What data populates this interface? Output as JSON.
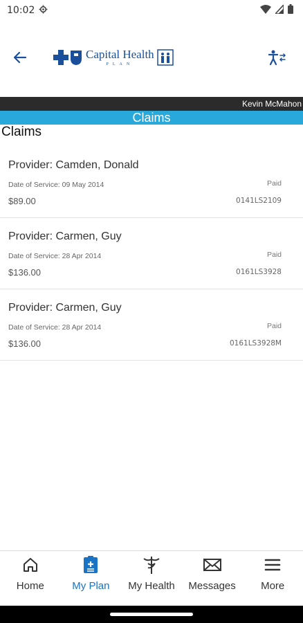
{
  "status_bar": {
    "time": "10:02"
  },
  "header": {
    "logo_name": "Capital Health",
    "logo_sub": "PLAN"
  },
  "user_bar": {
    "name": "Kevin McMahon"
  },
  "section_bar": {
    "title": "Claims"
  },
  "page": {
    "title": "Claims"
  },
  "claims": [
    {
      "provider": "Provider: Camden, Donald",
      "date": "Date of Service:  09 May 2014",
      "status": "Paid",
      "amount": "$89.00",
      "claim_id": "0141LS2109"
    },
    {
      "provider": "Provider: Carmen, Guy",
      "date": "Date of Service:  28 Apr 2014",
      "status": "Paid",
      "amount": "$136.00",
      "claim_id": "0161LS3928"
    },
    {
      "provider": "Provider: Carmen, Guy",
      "date": "Date of Service:  28 Apr 2014",
      "status": "Paid",
      "amount": "$136.00",
      "claim_id": "0161LS3928M"
    }
  ],
  "nav": {
    "home": "Home",
    "my_plan": "My Plan",
    "my_health": "My Health",
    "messages": "Messages",
    "more": "More"
  },
  "colors": {
    "brand_blue": "#1b4f9c",
    "section_bar": "#29a8db",
    "user_bar": "#2b2b2b",
    "nav_active": "#1a73c4"
  }
}
